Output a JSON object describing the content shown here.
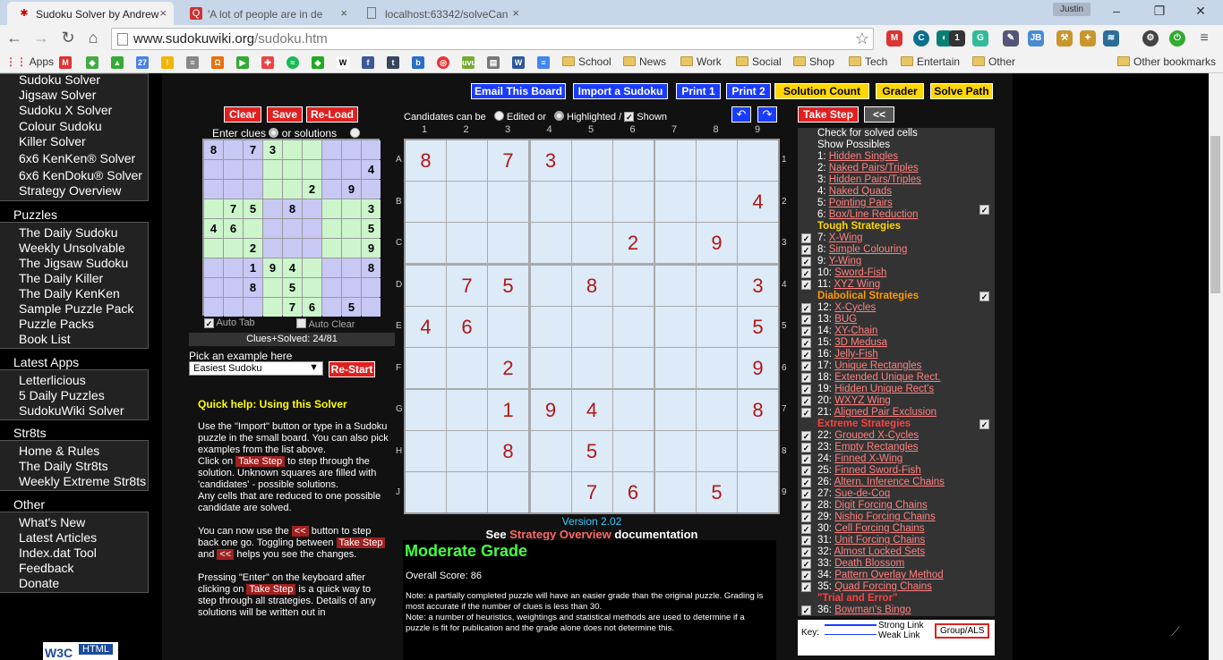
{
  "browser": {
    "tabs": [
      {
        "title": "Sudoku Solver by Andrew",
        "icon": "sudoku-favicon"
      },
      {
        "title": "'A lot of people are in de",
        "icon": "quote-favicon"
      },
      {
        "title": "localhost:63342/solveCan",
        "icon": "page-favicon"
      }
    ],
    "profile": "Justin",
    "url_domain": "www.sudokuwiki.org",
    "url_path": "/sudoku.htm",
    "bookmarks": [
      {
        "label": "Apps"
      },
      {
        "label": "School"
      },
      {
        "label": "News"
      },
      {
        "label": "Work"
      },
      {
        "label": "Social"
      },
      {
        "label": "Shop"
      },
      {
        "label": "Tech"
      },
      {
        "label": "Entertain"
      },
      {
        "label": "Other"
      },
      {
        "label": "Other bookmarks"
      }
    ]
  },
  "sidebar": {
    "top_items": [
      "Sudoku Solver",
      "Jigsaw Solver",
      "Sudoku X Solver",
      "Colour Sudoku",
      "Killer Solver",
      "6x6 KenKen® Solver",
      "6x6 KenDoku® Solver",
      "Strategy Overview"
    ],
    "sections": [
      {
        "title": "Puzzles",
        "items": [
          "The Daily Sudoku",
          "Weekly Unsolvable",
          "The Jigsaw Sudoku",
          "The Daily Killer",
          "The Daily KenKen",
          "Sample Puzzle Pack",
          "Puzzle Packs",
          "Book List"
        ]
      },
      {
        "title": "Latest Apps",
        "items": [
          "Letterlicious",
          "5 Daily Puzzles",
          "SudokuWiki Solver"
        ]
      },
      {
        "title": "Str8ts",
        "items": [
          "Home & Rules",
          "The Daily Str8ts",
          "Weekly Extreme Str8ts"
        ]
      },
      {
        "title": "Other",
        "items": [
          "What's New",
          "Latest Articles",
          "Index.dat Tool",
          "Feedback",
          "Donate"
        ]
      }
    ],
    "w3c": "HTML"
  },
  "toolbar": {
    "email": "Email This Board",
    "import": "Import a Sudoku",
    "print1": "Print 1",
    "print2": "Print 2",
    "solution_count": "Solution Count",
    "grader": "Grader",
    "solve_path": "Solve Path"
  },
  "mini": {
    "clear": "Clear",
    "save": "Save",
    "reload": "Re-Load",
    "enter_clues": "Enter clues",
    "or_solutions": "or solutions",
    "auto_tab": "Auto Tab",
    "auto_clear": "Auto Clear",
    "clues_solved": "Clues+Solved: 24/81",
    "pick_example": "Pick an example here",
    "example_selected": "Easiest Sudoku",
    "restart": "Re-Start"
  },
  "candidates": {
    "label": "Candidates can be",
    "edited": "Edited or",
    "highlighted": "Highlighted /",
    "shown": "Shown"
  },
  "board": {
    "cols": [
      "1",
      "2",
      "3",
      "4",
      "5",
      "6",
      "7",
      "8",
      "9"
    ],
    "rows": [
      "A",
      "B",
      "C",
      "D",
      "E",
      "F",
      "G",
      "H",
      "J"
    ],
    "cells": [
      [
        "8",
        "",
        "7",
        "3",
        "",
        "",
        "",
        "",
        ""
      ],
      [
        "",
        "",
        "",
        "",
        "",
        "",
        "",
        "",
        "4"
      ],
      [
        "",
        "",
        "",
        "",
        "",
        "2",
        "",
        "9",
        ""
      ],
      [
        "",
        "7",
        "5",
        "",
        "8",
        "",
        "",
        "",
        "3"
      ],
      [
        "4",
        "6",
        "",
        "",
        "",
        "",
        "",
        "",
        "5"
      ],
      [
        "",
        "",
        "2",
        "",
        "",
        "",
        "",
        "",
        "9"
      ],
      [
        "",
        "",
        "1",
        "9",
        "4",
        "",
        "",
        "",
        "8"
      ],
      [
        "",
        "",
        "8",
        "",
        "5",
        "",
        "",
        "",
        ""
      ],
      [
        "",
        "",
        "",
        "",
        "7",
        "6",
        "",
        "5",
        ""
      ]
    ]
  },
  "version": "Version 2.02",
  "see_docs": {
    "pre": "See",
    "link": "Strategy Overview",
    "post": "documentation"
  },
  "grade": {
    "title": "Moderate Grade",
    "score": "Overall Score: 86",
    "note1": "Note: a partially completed puzzle will have an easier grade than the original puzzle. Grading is most accurate if the number of clues is less than 30.",
    "note2": "Note: a number of heuristics, weightings and statistical methods are used to determine if a puzzle is fit for publication and the grade alone does not determine this."
  },
  "quick_help": {
    "title": "Quick help: Using this Solver",
    "p1": "Use the \"Import\" button or type in a Sudoku puzzle in the small board. You can also pick examples from the list above.",
    "p2a": "Click on",
    "take_step": "Take Step",
    "p2b": "to step through the solution. Unknown squares are filled with 'candidates' - possible solutions.",
    "p3": "Any cells that are reduced to one possible candidate are solved.",
    "p4a": "You can now use the",
    "back": "<<",
    "p4b": "button to step back one go. Toggling between",
    "and": "and",
    "p4c": "helps you see the changes.",
    "p5a": "Pressing \"Enter\" on the keyboard after clicking on",
    "p5b": "is a quick way to step through all strategies. Details of any solutions will be written out in"
  },
  "right": {
    "take_step": "Take Step",
    "back": "<<",
    "check_solved": "Check for solved cells",
    "show_possibles": "Show Possibles",
    "basic": [
      {
        "n": "1:",
        "l": "Hidden Singles"
      },
      {
        "n": "2:",
        "l": "Naked Pairs/Triples"
      },
      {
        "n": "3:",
        "l": "Hidden Pairs/Triples"
      },
      {
        "n": "4:",
        "l": "Naked Quads"
      },
      {
        "n": "5:",
        "l": "Pointing Pairs"
      },
      {
        "n": "6:",
        "l": "Box/Line Reduction"
      }
    ],
    "tough_title": "Tough Strategies",
    "tough": [
      {
        "n": "7:",
        "l": "X-Wing"
      },
      {
        "n": "8:",
        "l": "Simple Colouring"
      },
      {
        "n": "9:",
        "l": "Y-Wing"
      },
      {
        "n": "10:",
        "l": "Sword-Fish"
      },
      {
        "n": "11:",
        "l": "XYZ Wing"
      }
    ],
    "diabolical_title": "Diabolical Strategies",
    "diabolical": [
      {
        "n": "12:",
        "l": "X-Cycles"
      },
      {
        "n": "13:",
        "l": "BUG"
      },
      {
        "n": "14:",
        "l": "XY-Chain"
      },
      {
        "n": "15:",
        "l": "3D Medusa"
      },
      {
        "n": "16:",
        "l": "Jelly-Fish"
      },
      {
        "n": "17:",
        "l": "Unique Rectangles"
      },
      {
        "n": "18:",
        "l": "Extended Unique Rect."
      },
      {
        "n": "19:",
        "l": "Hidden Unique Rect's"
      },
      {
        "n": "20:",
        "l": "WXYZ Wing"
      },
      {
        "n": "21:",
        "l": "Aligned Pair Exclusion"
      }
    ],
    "extreme_title": "Extreme Strategies",
    "extreme": [
      {
        "n": "22:",
        "l": "Grouped X-Cycles"
      },
      {
        "n": "23:",
        "l": "Empty Rectangles"
      },
      {
        "n": "24:",
        "l": "Finned X-Wing"
      },
      {
        "n": "25:",
        "l": "Finned Sword-Fish"
      },
      {
        "n": "26:",
        "l": "Altern. Inference Chains"
      },
      {
        "n": "27:",
        "l": "Sue-de-Coq"
      },
      {
        "n": "28:",
        "l": "Digit Forcing Chains"
      },
      {
        "n": "29:",
        "l": "Nishio Forcing Chains"
      },
      {
        "n": "30:",
        "l": "Cell Forcing Chains"
      },
      {
        "n": "31:",
        "l": "Unit Forcing Chains"
      },
      {
        "n": "32:",
        "l": "Almost Locked Sets"
      },
      {
        "n": "33:",
        "l": "Death Blossom"
      },
      {
        "n": "34:",
        "l": "Pattern Overlay Method"
      },
      {
        "n": "35:",
        "l": "Quad Forcing Chains"
      }
    ],
    "trial_title": "\"Trial and Error\"",
    "trial": [
      {
        "n": "36:",
        "l": "Bowman's Bingo"
      }
    ],
    "key": "Key:",
    "strong": "Strong Link",
    "weak": "Weak Link",
    "group": "Group/ALS"
  },
  "colors": {
    "cell_bg": "#ddeaf7",
    "digit": "#b01818",
    "blue_btn": "#1a3cff",
    "yellow_btn": "#ffd700",
    "red_btn": "#e02020",
    "mini_green": "#ccf5cc",
    "mini_lilac": "#c8c8f5"
  }
}
